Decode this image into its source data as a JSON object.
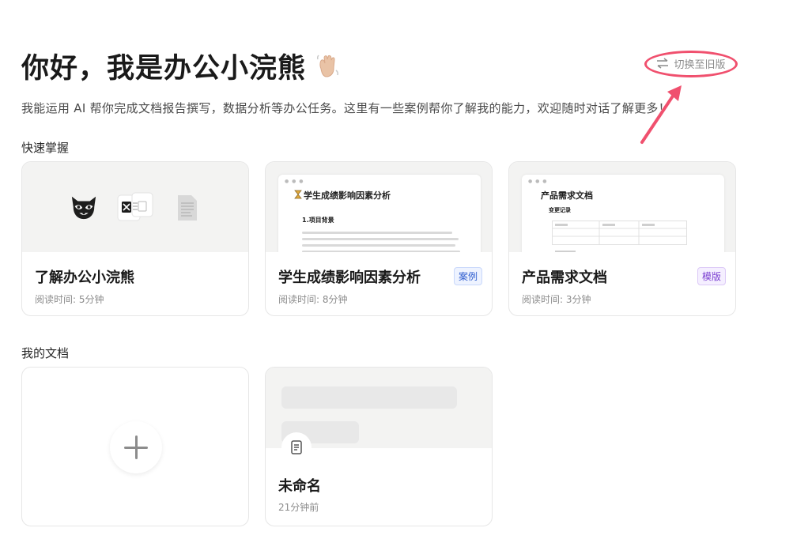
{
  "header": {
    "title": "你好，我是办公小浣熊",
    "wave_icon": "waving-hand-icon",
    "subtitle": "我能运用 AI 帮你完成文档报告撰写，数据分析等办公任务。这里有一些案例帮你了解我的能力，欢迎随时对话了解更多！",
    "switch_label": "切换至旧版",
    "switch_icon": "swap-arrows-icon"
  },
  "quick_start": {
    "label": "快速掌握",
    "cards": [
      {
        "title": "了解办公小浣熊",
        "meta": "阅读时间: 5分钟",
        "badge": ""
      },
      {
        "title": "学生成绩影响因素分析",
        "meta": "阅读时间: 8分钟",
        "badge": "案例",
        "preview_title": "学生成绩影响因素分析",
        "preview_sub": "1.项目背景"
      },
      {
        "title": "产品需求文档",
        "meta": "阅读时间: 3分钟",
        "badge": "模版",
        "preview_title": "产品需求文档",
        "preview_sub": "变更记录"
      }
    ]
  },
  "my_docs": {
    "label": "我的文档",
    "new_icon": "plus-icon",
    "items": [
      {
        "title": "未命名",
        "meta": "21分钟前",
        "icon": "document-icon"
      }
    ]
  },
  "colors": {
    "accent_ring": "#f0506e",
    "badge_case": "#2f5ecf",
    "badge_template": "#7b3fd1"
  }
}
